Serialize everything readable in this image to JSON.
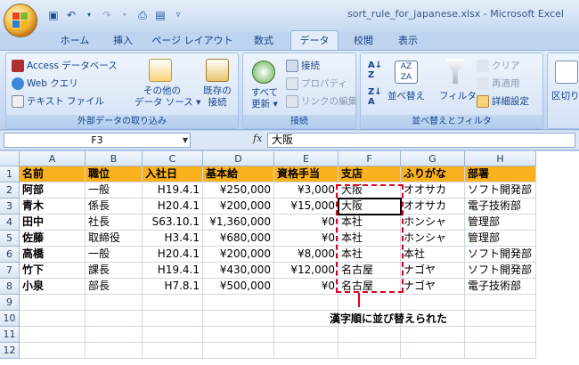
{
  "window": {
    "title": "sort_rule_for_japanese.xlsx - Microsoft Excel"
  },
  "tabs": [
    "ホーム",
    "挿入",
    "ページ レイアウト",
    "数式",
    "データ",
    "校閲",
    "表示"
  ],
  "active_tab": "データ",
  "ribbon": {
    "external": {
      "label": "外部データの取り込み",
      "access": "Access データベース",
      "web": "Web クエリ",
      "text": "テキスト ファイル",
      "other_line1": "その他の",
      "other_line2": "データ ソース ▾",
      "existing_line1": "既存の",
      "existing_line2": "接続"
    },
    "connections": {
      "label": "接続",
      "refresh_line1": "すべて",
      "refresh_line2": "更新 ▾",
      "connections": "接続",
      "properties": "プロパティ",
      "edit_links": "リンクの編集"
    },
    "sort_filter": {
      "label": "並べ替えとフィルタ",
      "sort": "並べ替え",
      "filter": "フィルタ",
      "clear": "クリア",
      "reapply": "再適用",
      "advanced": "詳細設定"
    },
    "tools": {
      "text_to_columns": "区切り"
    }
  },
  "formula_bar": {
    "name_box": "F3",
    "fx": "fx",
    "value": "大阪"
  },
  "columns": [
    "A",
    "B",
    "C",
    "D",
    "E",
    "F",
    "G",
    "H"
  ],
  "rows": [
    "1",
    "2",
    "3",
    "4",
    "5",
    "6",
    "7",
    "8",
    "9",
    "10",
    "11",
    "12"
  ],
  "table": {
    "headers": [
      "名前",
      "職位",
      "入社日",
      "基本給",
      "資格手当",
      "支店",
      "ふりがな",
      "部署"
    ],
    "data": [
      [
        "阿部",
        "一般",
        "H19.4.1",
        "¥250,000",
        "¥3,000",
        "大阪",
        "オオサカ",
        "ソフト開発部"
      ],
      [
        "青木",
        "係長",
        "H20.4.1",
        "¥200,000",
        "¥15,000",
        "大阪",
        "オオサカ",
        "電子技術部"
      ],
      [
        "田中",
        "社長",
        "S63.10.1",
        "¥1,360,000",
        "¥0",
        "本社",
        "ホンシャ",
        "管理部"
      ],
      [
        "佐藤",
        "取締役",
        "H3.4.1",
        "¥680,000",
        "¥0",
        "本社",
        "ホンシャ",
        "管理部"
      ],
      [
        "高橋",
        "一般",
        "H20.4.1",
        "¥200,000",
        "¥8,000",
        "本社",
        "本社",
        "ソフト開発部"
      ],
      [
        "竹下",
        "課長",
        "H19.4.1",
        "¥430,000",
        "¥12,000",
        "名古屋",
        "ナゴヤ",
        "ソフト開発部"
      ],
      [
        "小泉",
        "部長",
        "H7.8.1",
        "¥500,000",
        "¥0",
        "名古屋",
        "ナゴヤ",
        "電子技術部"
      ]
    ]
  },
  "annotation": "漢字順に並び替えられた",
  "colors": {
    "header_fill": "#f9b11e",
    "annotation_red": "#e0001b"
  }
}
